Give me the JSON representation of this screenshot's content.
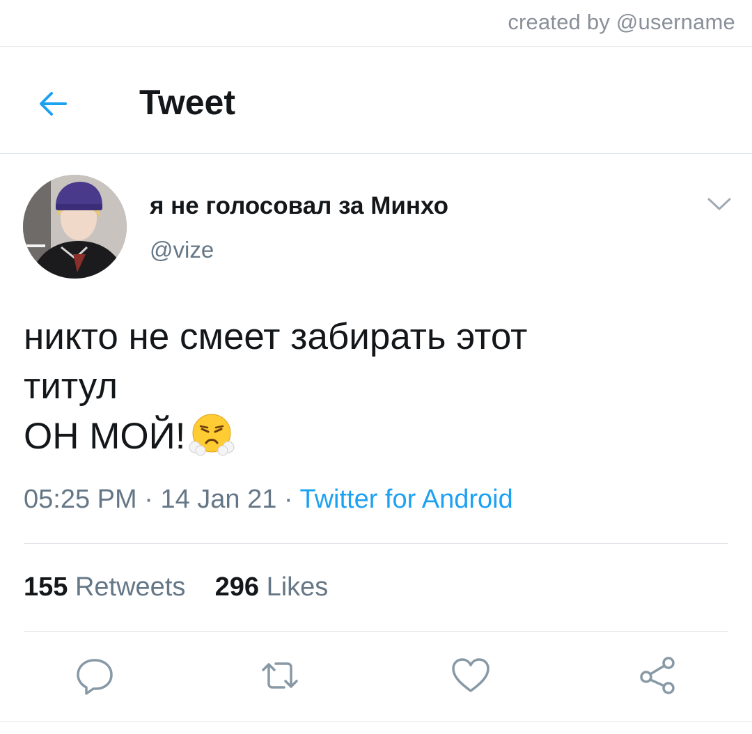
{
  "watermark": "created by @username",
  "header": {
    "title": "Tweet"
  },
  "tweet": {
    "display_name": "я не голосовал за Минхо",
    "handle": "@vize",
    "text_lines": [
      "никто не смеет забирать этот",
      "титул",
      "ОН МОЙ!"
    ],
    "emoji": "face-with-steam-from-nose",
    "time": "05:25 PM",
    "date": "14 Jan 21",
    "separator": "·",
    "source": "Twitter for Android",
    "retweets_count": "155",
    "retweets_label": "Retweets",
    "likes_count": "296",
    "likes_label": "Likes"
  },
  "icons": {
    "back": "arrow-left-icon",
    "more": "chevron-down-icon",
    "reply": "reply-icon",
    "retweet": "retweet-icon",
    "like": "heart-icon",
    "share": "share-icon"
  },
  "colors": {
    "accent": "#1da1f2",
    "text": "#14171a",
    "secondary": "#657786",
    "divider": "#e1e6ea"
  }
}
